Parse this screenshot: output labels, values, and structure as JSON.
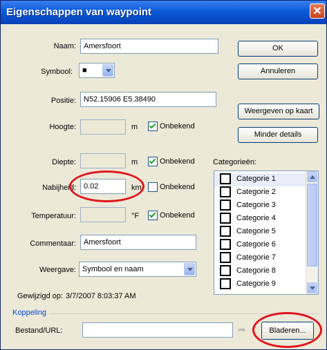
{
  "window": {
    "title": "Eigenschappen van waypoint",
    "close_glyph": "✕"
  },
  "fields": {
    "naam": {
      "label": "Naam:",
      "value": "Amersfoort"
    },
    "symbool": {
      "label": "Symbool:",
      "value": "■"
    },
    "positie": {
      "label": "Positie:",
      "value": "N52.15906 E5.38490"
    },
    "hoogte": {
      "label": "Hoogte:",
      "unit": "m",
      "unknown_label": "Onbekend",
      "unknown_checked": true
    },
    "diepte": {
      "label": "Diepte:",
      "unit": "m",
      "unknown_label": "Onbekend",
      "unknown_checked": true
    },
    "nabijheid": {
      "label": "Nabijheid:",
      "value": "0.02",
      "unit": "km",
      "unknown_label": "Onbekend",
      "unknown_checked": false
    },
    "temperatuur": {
      "label": "Temperatuur:",
      "unit": "°F",
      "unknown_label": "Onbekend",
      "unknown_checked": true
    },
    "commentaar": {
      "label": "Commentaar:",
      "value": "Amersfoort"
    },
    "weergave": {
      "label": "Weergave:",
      "value": "Symbool en naam"
    },
    "gewijzigd": {
      "label": "Gewijzigd op:",
      "value": "3/7/2007 8:03:37 AM"
    }
  },
  "buttons": {
    "ok": "OK",
    "annuleren": "Annuleren",
    "weergeven_op_kaart": "Weergeven op kaart",
    "minder_details": "Minder details",
    "bladeren": "Bladeren..."
  },
  "categories": {
    "label": "Categorieën:",
    "items": [
      "Categorie 1",
      "Categorie 2",
      "Categorie 3",
      "Categorie 4",
      "Categorie 5",
      "Categorie 6",
      "Categorie 7",
      "Categorie 8",
      "Categorie 9"
    ]
  },
  "koppeling": {
    "group_label": "Koppeling",
    "bestand_label": "Bestand/URL:",
    "arrow_glyph": "➦"
  },
  "colors": {
    "title_bar": "#0a5bd8",
    "annotation_red": "#e0141e",
    "dialog_bg": "#ece9d8"
  }
}
